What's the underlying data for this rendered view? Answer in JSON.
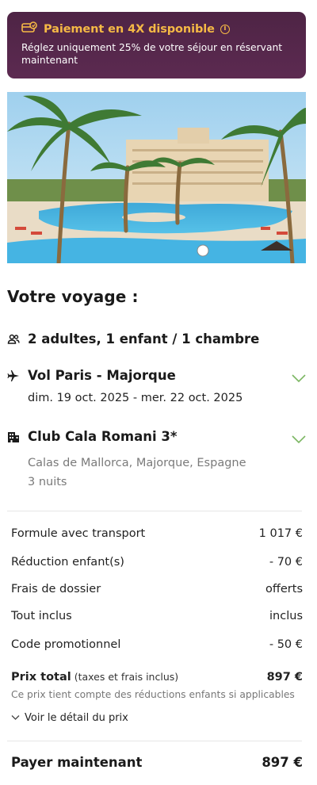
{
  "banner": {
    "title": "Paiement en 4X disponible",
    "text": "Réglez uniquement 25% de votre séjour en réservant maintenant",
    "accent_color": "#f5b945",
    "background_color": "#4e2445"
  },
  "hero": {
    "alt": "Hotel pool with palm trees"
  },
  "trip": {
    "title": "Votre voyage :",
    "travelers": "2 adultes, 1 enfant / 1 chambre",
    "flight": {
      "title": "Vol Paris - Majorque",
      "dates": "dim. 19 oct. 2025 - mer. 22 oct. 2025"
    },
    "hotel": {
      "title": "Club Cala Romani 3*",
      "location": "Calas de Mallorca, Majorque, Espagne",
      "nights": "3 nuits"
    },
    "chevron_color": "#7bb662"
  },
  "prices": {
    "lines": [
      {
        "label": "Formule avec transport",
        "value": "1 017 €"
      },
      {
        "label": "Réduction enfant(s)",
        "value": "- 70 €"
      },
      {
        "label": "Frais de dossier",
        "value": "offerts"
      },
      {
        "label": "Tout inclus",
        "value": "inclus"
      },
      {
        "label": "Code promotionnel",
        "value": "- 50 €"
      }
    ],
    "total_label": "Prix total",
    "total_sub": "(taxes et frais inclus)",
    "total_value": "897 €",
    "note": "Ce prix tient compte des réductions enfants si applicables",
    "detail_link": "Voir le détail du prix",
    "pay_now_label": "Payer maintenant",
    "pay_now_value": "897 €"
  }
}
